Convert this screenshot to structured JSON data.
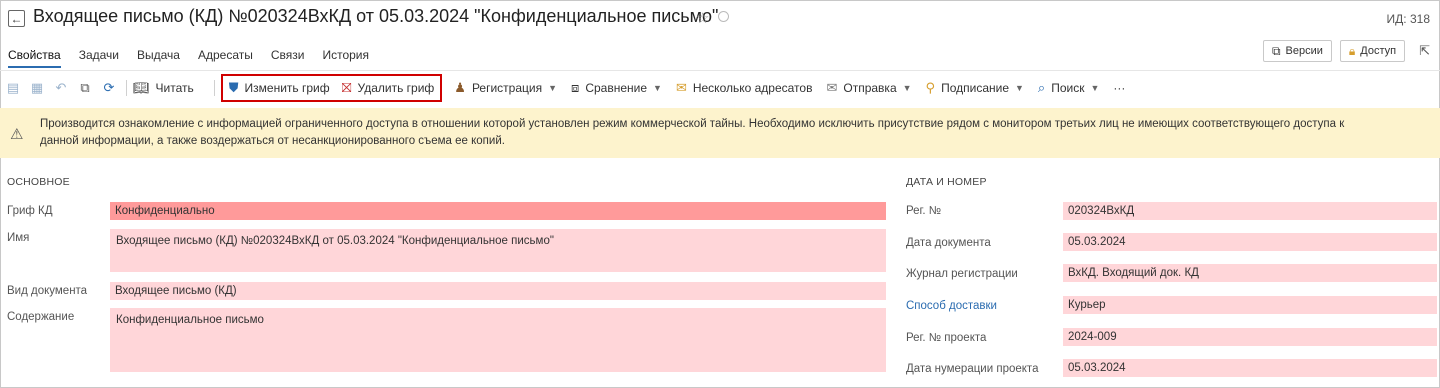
{
  "window": {
    "title": "Входящее письмо (КД) №020324ВхКД от 05.03.2024 \"Конфиденциальное письмо\"",
    "id_label": "ИД: 318",
    "back_icon": "arrow-left-icon",
    "star_icon": "star-icon"
  },
  "tabs": [
    "Свойства",
    "Задачи",
    "Выдача",
    "Адресаты",
    "Связи",
    "История"
  ],
  "header_buttons": {
    "versions": "Версии",
    "access": "Доступ"
  },
  "toolbar": {
    "read": "Читать",
    "change_stamp": "Изменить гриф",
    "delete_stamp": "Удалить гриф",
    "registration": "Регистрация",
    "comparison": "Сравнение",
    "multi_addressees": "Несколько адресатов",
    "send": "Отправка",
    "signing": "Подписание",
    "search": "Поиск",
    "more": "···"
  },
  "warning": {
    "text": "Производится ознакомление с информацией ограниченного доступа в отношении которой установлен режим коммерческой тайны. Необходимо исключить присутствие рядом с монитором третьих лиц не имеющих соответствующего доступа к\nданной информации, а также воздержаться от несанкционированного съема ее копий."
  },
  "main": {
    "section_title": "ОСНОВНОЕ",
    "fields": {
      "stamp_label": "Гриф КД",
      "stamp_value": "Конфиденциально",
      "name_label": "Имя",
      "name_value": "Входящее письмо (КД) №020324ВхКД от 05.03.2024 \"Конфиденциальное письмо\"",
      "doc_type_label": "Вид документа",
      "doc_type_value": "Входящее письмо (КД)",
      "content_label": "Содержание",
      "content_value": "Конфиденциальное письмо"
    }
  },
  "date_number": {
    "section_title": "ДАТА И НОМЕР",
    "fields": {
      "reg_no_label": "Рег. №",
      "reg_no_value": "020324ВхКД",
      "doc_date_label": "Дата документа",
      "doc_date_value": "05.03.2024",
      "journal_label": "Журнал регистрации",
      "journal_value": "ВхКД. Входящий док. КД",
      "delivery_label": "Способ доставки",
      "delivery_value": "Курьер",
      "project_no_label": "Рег. № проекта",
      "project_no_value": "2024-009",
      "project_date_label": "Дата нумерации проекта",
      "project_date_value": "05.03.2024"
    }
  },
  "colors": {
    "accent": "#2b6cb0",
    "warning_bg": "#fdf3cd",
    "field_bg": "#ffd6d9",
    "stamp_bg": "#ff9a9a",
    "highlight_border": "#d00000"
  }
}
